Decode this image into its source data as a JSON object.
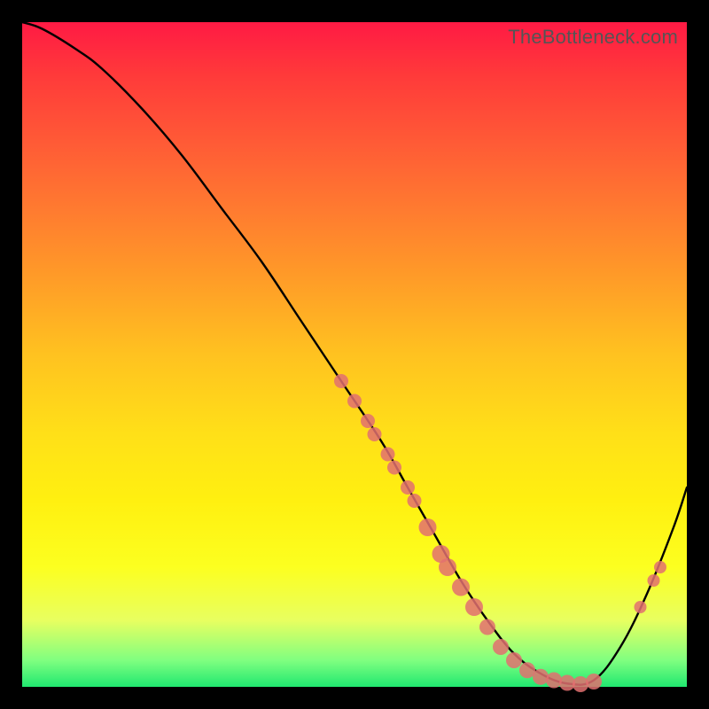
{
  "watermark": "TheBottleneck.com",
  "chart_data": {
    "type": "line",
    "title": "",
    "xlabel": "",
    "ylabel": "",
    "xlim": [
      0,
      100
    ],
    "ylim": [
      0,
      100
    ],
    "grid": false,
    "legend": false,
    "series": [
      {
        "name": "bottleneck-curve",
        "x": [
          0,
          3,
          8,
          12,
          18,
          24,
          30,
          36,
          42,
          48,
          54,
          58,
          62,
          66,
          70,
          74,
          78,
          82,
          86,
          90,
          94,
          98,
          100
        ],
        "y": [
          100,
          99,
          96,
          93,
          87,
          80,
          72,
          64,
          55,
          46,
          37,
          30,
          23,
          16,
          10,
          5,
          2,
          0.5,
          1,
          6,
          14,
          24,
          30
        ],
        "color": "#000000"
      }
    ],
    "scatter_points": {
      "name": "highlighted-points",
      "color": "#e27070",
      "radius_groups": [
        {
          "r": 8,
          "points": [
            {
              "x": 48,
              "y": 46
            },
            {
              "x": 50,
              "y": 43
            },
            {
              "x": 52,
              "y": 40
            },
            {
              "x": 53,
              "y": 38
            },
            {
              "x": 55,
              "y": 35
            },
            {
              "x": 56,
              "y": 33
            },
            {
              "x": 58,
              "y": 30
            },
            {
              "x": 59,
              "y": 28
            }
          ]
        },
        {
          "r": 10,
          "points": [
            {
              "x": 61,
              "y": 24
            },
            {
              "x": 63,
              "y": 20
            },
            {
              "x": 64,
              "y": 18
            },
            {
              "x": 66,
              "y": 15
            },
            {
              "x": 68,
              "y": 12
            }
          ]
        },
        {
          "r": 9,
          "points": [
            {
              "x": 70,
              "y": 9
            },
            {
              "x": 72,
              "y": 6
            },
            {
              "x": 74,
              "y": 4
            },
            {
              "x": 76,
              "y": 2.5
            },
            {
              "x": 78,
              "y": 1.5
            },
            {
              "x": 80,
              "y": 1
            },
            {
              "x": 82,
              "y": 0.6
            },
            {
              "x": 84,
              "y": 0.4
            },
            {
              "x": 86,
              "y": 0.8
            }
          ]
        },
        {
          "r": 7,
          "points": [
            {
              "x": 93,
              "y": 12
            },
            {
              "x": 95,
              "y": 16
            },
            {
              "x": 96,
              "y": 18
            }
          ]
        }
      ]
    },
    "background_gradient": {
      "top": "#ff1a44",
      "mid_top": "#ff9a28",
      "mid": "#ffe018",
      "mid_bottom": "#fcff20",
      "bottom": "#20e870"
    }
  }
}
